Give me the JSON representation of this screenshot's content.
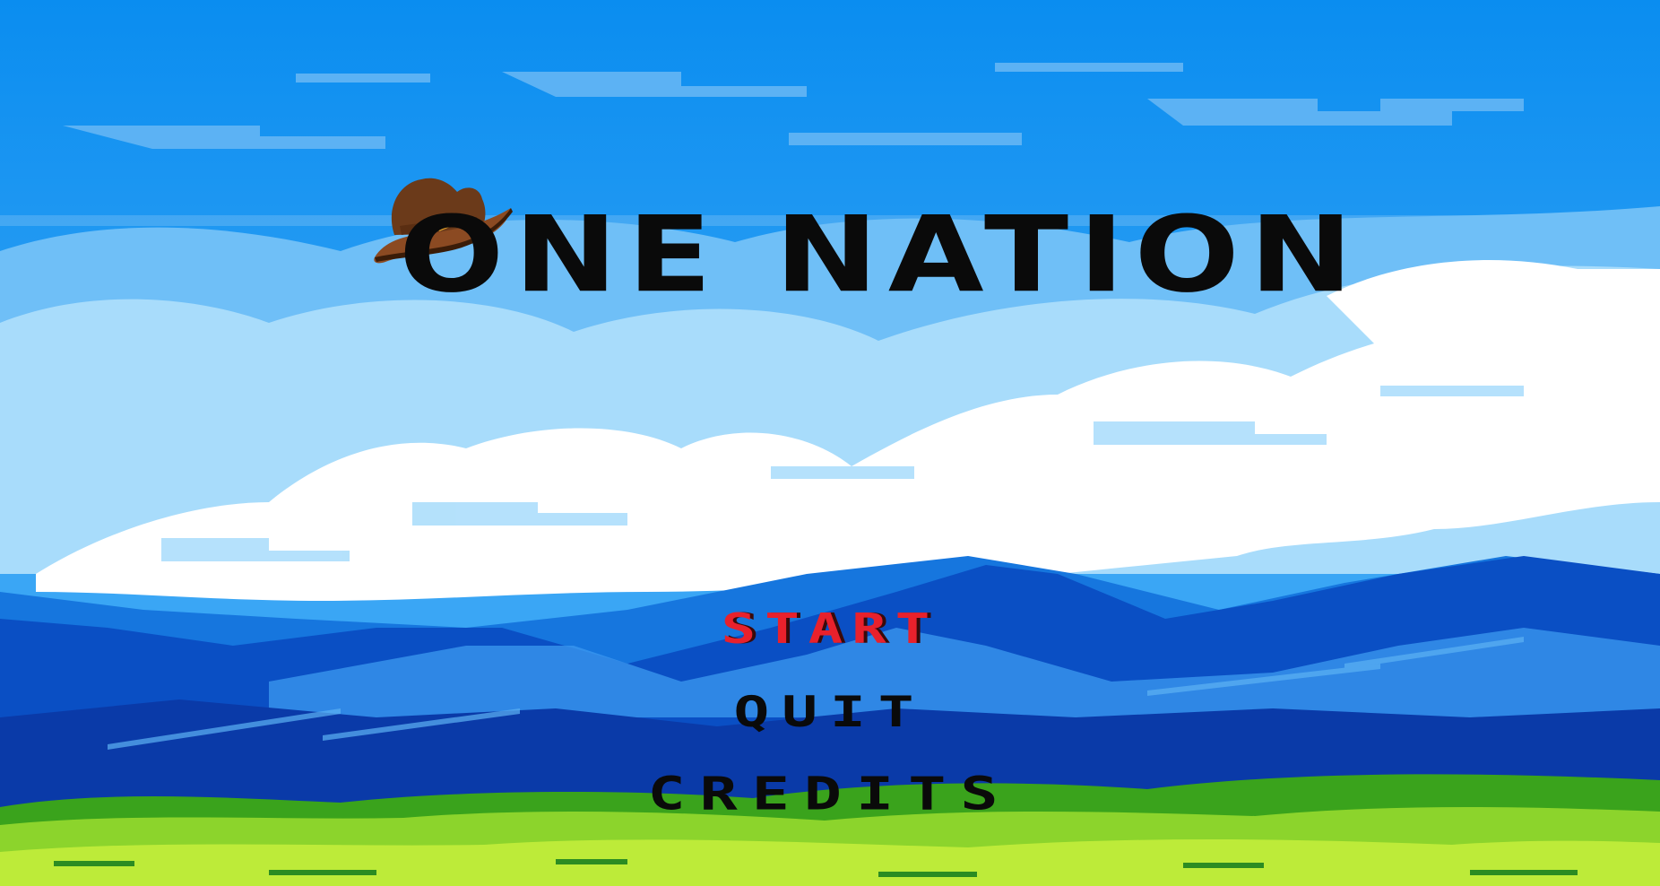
{
  "game": {
    "title": "ONE NATION",
    "logo_icon": "cowboy-hat-icon"
  },
  "menu": {
    "start": "START",
    "quit": "QUIT",
    "credits": "CREDITS",
    "selected": "START"
  },
  "colors": {
    "sky": "#0a8df0",
    "selected_item": "#e8212c",
    "menu_text": "#0a0a0a",
    "mountains": "#0a4fc4",
    "grass": "#8cd42c"
  }
}
